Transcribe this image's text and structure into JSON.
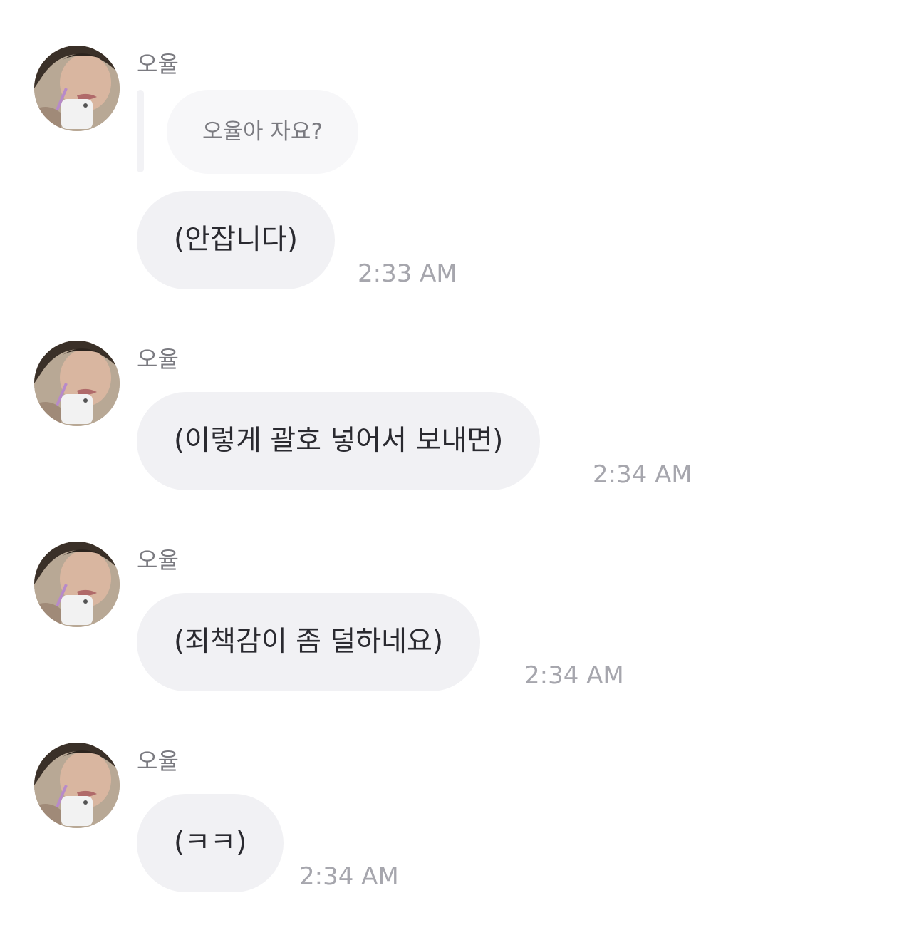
{
  "messages": [
    {
      "sender": "오율",
      "quote": "오율아 자요?",
      "text": "(안잡니다)",
      "time": "2:33 AM"
    },
    {
      "sender": "오율",
      "text": "(이렇게 괄호 넣어서 보내면)",
      "time": "2:34 AM"
    },
    {
      "sender": "오율",
      "text": "(죄책감이 좀 덜하네요)",
      "time": "2:34 AM"
    },
    {
      "sender": "오율",
      "text": "(ㅋㅋ)",
      "time": "2:34 AM"
    }
  ],
  "colors": {
    "bubble": "#f1f1f4",
    "quote_bubble": "#f7f7f9",
    "text": "#2a2a30",
    "timestamp": "#a6a6ad",
    "sender": "#7a7a80"
  }
}
